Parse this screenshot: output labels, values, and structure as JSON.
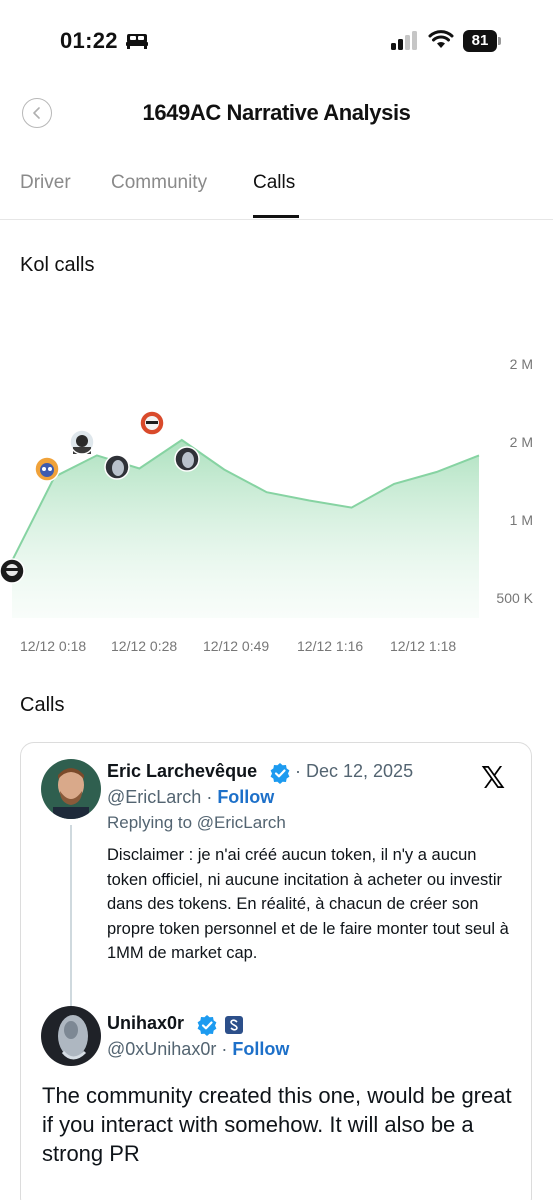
{
  "status_bar": {
    "time": "01:22",
    "battery": "81"
  },
  "header": {
    "title": "1649AC Narrative Analysis"
  },
  "tabs": [
    {
      "label": "Driver",
      "active": false
    },
    {
      "label": "Community",
      "active": false
    },
    {
      "label": "Calls",
      "active": true
    }
  ],
  "kol_section": {
    "title": "Kol calls"
  },
  "chart_data": {
    "type": "area",
    "title": "Kol calls",
    "x_tick_labels": [
      "12/12 0:18",
      "12/12 0:28",
      "12/12 0:49",
      "12/12 1:16",
      "12/12 1:18"
    ],
    "y_tick_labels": [
      "2 M",
      "2 M",
      "1 M",
      "500 K"
    ],
    "ylim": [
      400000,
      2400000
    ],
    "y_tick_values": [
      2200000,
      1700000,
      1200000,
      700000
    ],
    "x": [
      0,
      1,
      2,
      3,
      4,
      5,
      6,
      7,
      8,
      9,
      10,
      11,
      12,
      13
    ],
    "values": [
      730000,
      1440000,
      1620000,
      1510000,
      1750000,
      1500000,
      1310000,
      1240000,
      1180000,
      1380000,
      1480000,
      1620000
    ],
    "grid": false,
    "fill_color": "#b9e5c8",
    "line_color": "#7dcf99"
  },
  "calls_section": {
    "title": "Calls"
  },
  "tweet": {
    "author_name": "Eric Larchevêque",
    "date": "Dec 12, 2025",
    "handle": "@EricLarch",
    "follow": "Follow",
    "replying_to": "Replying to @EricLarch",
    "body": "Disclaimer : je n'ai créé aucun token, il n'y a aucun token officiel, ni aucune incitation à acheter ou investir dans des tokens. En réalité, à chacun de créer son propre token personnel et de le faire monter tout seul à 1MM de market cap.",
    "reply_author_name": "Unihax0r",
    "reply_handle": "@0xUnihax0r",
    "reply_follow": "Follow",
    "reply_body": "The community created this one, would be great if you interact with somehow. It will also be a strong PR"
  }
}
